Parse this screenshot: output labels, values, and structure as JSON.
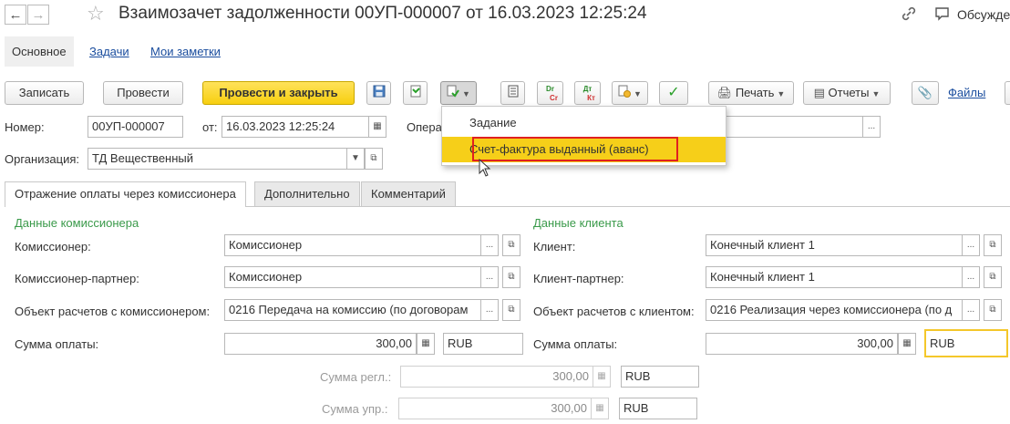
{
  "window": {
    "title": "Взаимозачет задолженности 00УП-000007 от 16.03.2023 12:25:24",
    "discuss_label": "Обсуждение"
  },
  "sections": {
    "main": "Основное",
    "tasks": "Задачи",
    "notes": "Мои заметки"
  },
  "toolbar": {
    "save": "Записать",
    "post": "Провести",
    "post_close": "Провести и закрыть",
    "print": "Печать",
    "reports": "Отчеты",
    "files": "Файлы",
    "dt_cr_top": "Dr",
    "dt_cr_bottom": "Cr",
    "dt_kt_top": "Дт",
    "dt_kt_bottom": "Кт"
  },
  "header_fields": {
    "number_label": "Номер:",
    "number_value": "00УП-000007",
    "date_label": "от:",
    "date_value": "16.03.2023 12:25:24",
    "operation_label": "Опера",
    "org_label": "Организация:",
    "org_value": "ТД Вещественный"
  },
  "popup_menu": {
    "items": [
      "Задание",
      "Счет-фактура выданный (аванс)"
    ]
  },
  "tabs": [
    "Отражение оплаты через комиссионера",
    "Дополнительно",
    "Комментарий"
  ],
  "commissioner": {
    "title": "Данные комиссионера",
    "commissioner_label": "Комиссионер:",
    "commissioner_value": "Комиссионер",
    "partner_label": "Комиссионер-партнер:",
    "partner_value": "Комиссионер",
    "object_label": "Объект расчетов с комиссионером:",
    "object_value": "0216 Передача на комиссию (по договорам",
    "sum_label": "Сумма оплаты:",
    "sum_value": "300,00",
    "currency": "RUB"
  },
  "client": {
    "title": "Данные клиента",
    "client_label": "Клиент:",
    "client_value": "Конечный клиент 1",
    "partner_label": "Клиент-партнер:",
    "partner_value": "Конечный клиент 1",
    "object_label": "Объект расчетов с клиентом:",
    "object_value": "0216 Реализация через комиссионера (по д",
    "sum_label": "Сумма оплаты:",
    "sum_value": "300,00",
    "currency": "RUB"
  },
  "extra_sums": {
    "regl_label": "Сумма регл.:",
    "regl_value": "300,00",
    "regl_currency": "RUB",
    "upr_label": "Сумма упр.:",
    "upr_value": "300,00",
    "upr_currency": "RUB"
  },
  "icons": {
    "back": "arrow-left-icon",
    "forward": "arrow-right-icon",
    "favorite": "star-icon",
    "link": "link-icon",
    "discuss": "chat-icon"
  }
}
